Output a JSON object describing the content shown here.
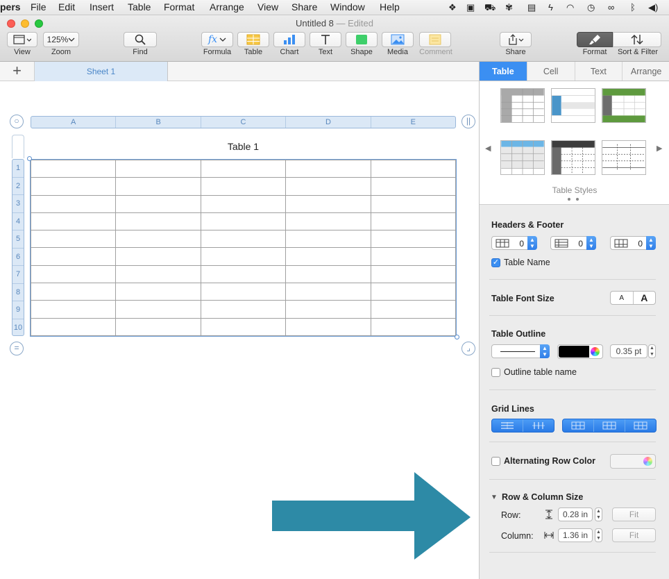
{
  "menubar": {
    "app": "pers",
    "items": [
      "File",
      "Edit",
      "Insert",
      "Table",
      "Format",
      "Arrange",
      "View",
      "Share",
      "Window",
      "Help"
    ]
  },
  "window": {
    "title": "Untitled 8",
    "edited": "— Edited"
  },
  "toolbar": {
    "view": "View",
    "zoom_value": "125%",
    "zoom": "Zoom",
    "find": "Find",
    "formula": "Formula",
    "table": "Table",
    "chart": "Chart",
    "text": "Text",
    "shape": "Shape",
    "media": "Media",
    "comment": "Comment",
    "share": "Share",
    "format": "Format",
    "sort_filter": "Sort & Filter"
  },
  "sheet_tabs": [
    "Sheet 1"
  ],
  "table": {
    "title": "Table 1",
    "columns": [
      "A",
      "B",
      "C",
      "D",
      "E"
    ],
    "rows": [
      "1",
      "2",
      "3",
      "4",
      "5",
      "6",
      "7",
      "8",
      "9",
      "10"
    ]
  },
  "inspector": {
    "tabs": [
      "Table",
      "Cell",
      "Text",
      "Arrange"
    ],
    "active_tab": "Table",
    "styles_label": "Table Styles",
    "headers_footer": {
      "title": "Headers & Footer",
      "header_rows": "0",
      "header_columns": "0",
      "footer_rows": "0"
    },
    "table_name_label": "Table Name",
    "table_name_checked": true,
    "font_size": {
      "title": "Table Font Size",
      "smaller": "A",
      "larger": "A"
    },
    "outline": {
      "title": "Table Outline",
      "width": "0.35 pt",
      "color": "#000000",
      "outline_name_label": "Outline table name"
    },
    "grid_lines": {
      "title": "Grid Lines"
    },
    "alternating": {
      "label": "Alternating Row Color"
    },
    "row_col_size": {
      "title": "Row & Column Size",
      "row_label": "Row:",
      "row_value": "0.28 in",
      "column_label": "Column:",
      "column_value": "1.36 in",
      "fit": "Fit"
    }
  },
  "colors": {
    "accent": "#3b8ff2",
    "arrow": "#2d8aa6"
  }
}
